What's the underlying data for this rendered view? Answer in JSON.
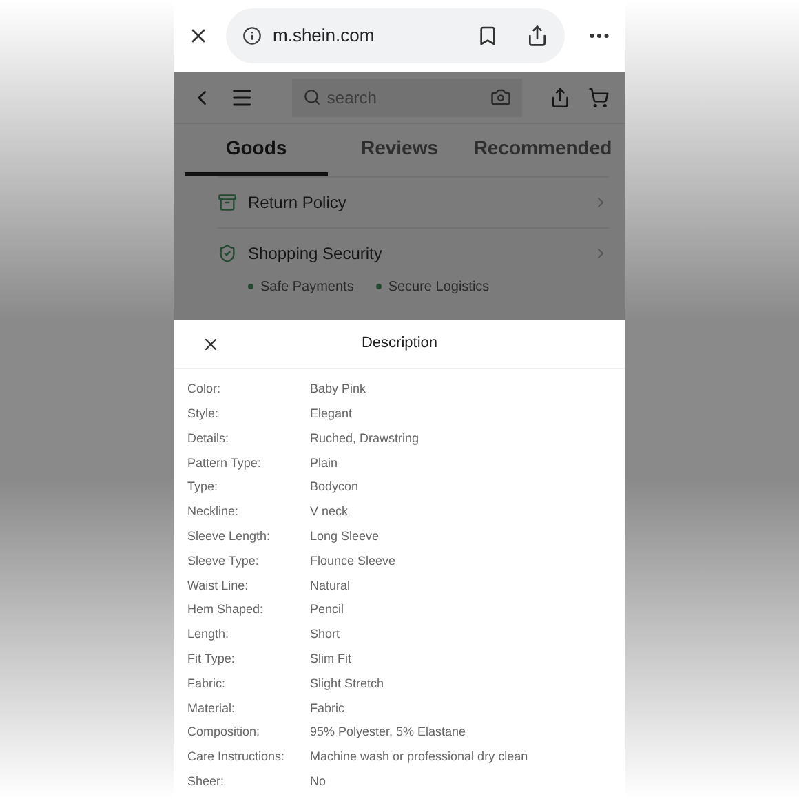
{
  "browser": {
    "url": "m.shein.com"
  },
  "header": {
    "search_placeholder": "search"
  },
  "tabs": [
    {
      "label": "Goods",
      "selected": true
    },
    {
      "label": "Reviews",
      "selected": false
    },
    {
      "label": "Recommended",
      "selected": false
    }
  ],
  "services": [
    {
      "kind": "return",
      "label": "Return Policy"
    },
    {
      "kind": "security",
      "label": "Shopping Security",
      "features": [
        "Safe Payments",
        "Secure Logistics"
      ]
    }
  ],
  "sheet": {
    "title": "Description",
    "attributes": [
      {
        "label": "Color:",
        "value": "Baby Pink"
      },
      {
        "label": "Style:",
        "value": "Elegant"
      },
      {
        "label": "Details:",
        "value": "Ruched, Drawstring"
      },
      {
        "label": "Pattern Type:",
        "value": "Plain"
      },
      {
        "label": "Type:",
        "value": "Bodycon"
      },
      {
        "label": "Neckline:",
        "value": "V neck"
      },
      {
        "label": "Sleeve Length:",
        "value": "Long Sleeve"
      },
      {
        "label": "Sleeve Type:",
        "value": "Flounce Sleeve"
      },
      {
        "label": "Waist Line:",
        "value": "Natural"
      },
      {
        "label": "Hem Shaped:",
        "value": "Pencil"
      },
      {
        "label": "Length:",
        "value": "Short"
      },
      {
        "label": "Fit Type:",
        "value": "Slim Fit"
      },
      {
        "label": "Fabric:",
        "value": "Slight Stretch"
      },
      {
        "label": "Material:",
        "value": "Fabric"
      },
      {
        "label": "Composition:",
        "value": "95% Polyester, 5% Elastane"
      },
      {
        "label": "Care Instructions:",
        "value": "Machine wash or professional dry clean"
      },
      {
        "label": "Sheer:",
        "value": "No"
      }
    ]
  }
}
